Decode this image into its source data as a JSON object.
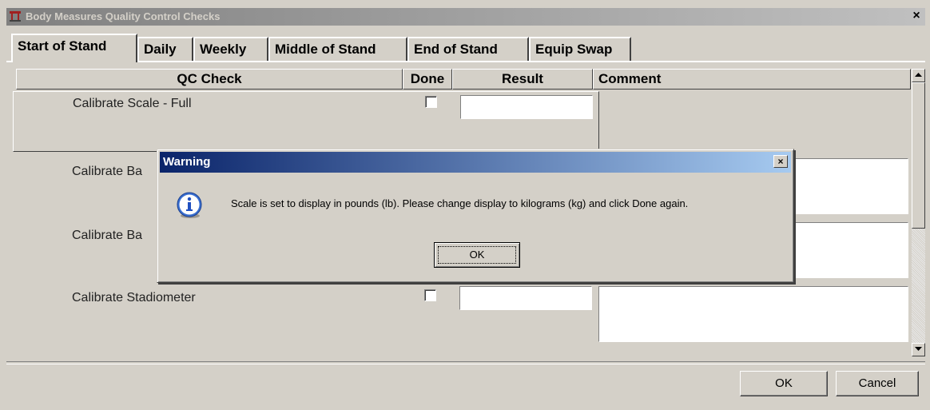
{
  "window": {
    "title": "Body Measures Quality Control Checks",
    "close_glyph": "×"
  },
  "tabs": [
    {
      "label": "Start of Stand",
      "active": true
    },
    {
      "label": "Daily"
    },
    {
      "label": "Weekly"
    },
    {
      "label": "Middle of Stand"
    },
    {
      "label": "End of Stand"
    },
    {
      "label": "Equip Swap"
    }
  ],
  "grid": {
    "headers": {
      "qc_check": "QC Check",
      "done": "Done",
      "result": "Result",
      "comment": "Comment"
    },
    "rows": [
      {
        "check": "Calibrate Scale - Full",
        "done": false,
        "result": "",
        "comment": ""
      },
      {
        "check": "Calibrate Ba",
        "done": false,
        "result": "",
        "comment": ""
      },
      {
        "check": "Calibrate Ba",
        "done": false,
        "result": "",
        "comment": ""
      },
      {
        "check": "Calibrate Stadiometer",
        "done": false,
        "result": "",
        "comment": ""
      }
    ]
  },
  "buttons": {
    "ok": "OK",
    "cancel": "Cancel"
  },
  "dialog": {
    "title": "Warning",
    "close_glyph": "×",
    "icon": "info-icon",
    "message": "Scale is set to display in pounds (lb).  Please change display to kilograms (kg) and click Done again.",
    "ok_label": "OK"
  },
  "colors": {
    "dialog_title_start": "#0a246a",
    "dialog_title_end": "#a6caf0",
    "face": "#d4d0c8"
  }
}
